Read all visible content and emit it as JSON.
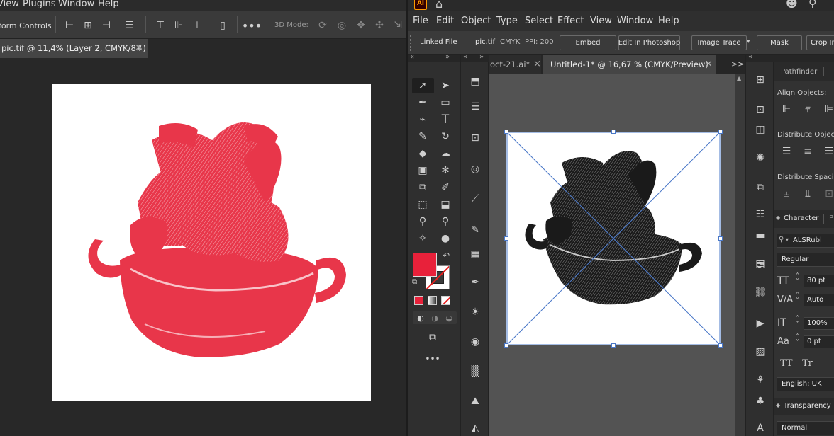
{
  "left": {
    "menu": [
      "View",
      "Plugins",
      "Window",
      "Help"
    ],
    "control_label": "form Controls",
    "threed_label": "3D Mode:",
    "tab_title": "pic.tif @ 11,4% (Layer 2, CMYK/8#)",
    "tab_close": "×"
  },
  "right": {
    "app_logo": "Ai",
    "menu": [
      "File",
      "Edit",
      "Object",
      "Type",
      "Select",
      "Effect",
      "View",
      "Window",
      "Help"
    ],
    "control": {
      "linked_file": "Linked File",
      "file_name": "pic.tif",
      "color_mode": "CMYK",
      "ppi": "PPI: 200",
      "embed": "Embed",
      "edit_in_photoshop": "Edit In Photoshop",
      "image_trace": "Image Trace",
      "mask": "Mask",
      "crop_image": "Crop Ima"
    },
    "tabs": {
      "first": "oct-21.ai*",
      "first_close": "×",
      "second": "Untitled-1* @ 16,67 % (CMYK/Preview)",
      "second_close": "×",
      "overflow": ">>"
    },
    "panel": {
      "pathfinder_tab": "Pathfinder",
      "align_objects": "Align Objects:",
      "distribute_objects": "Distribute Objects",
      "distribute_spacing": "Distribute Spacing",
      "character_tab": "Character",
      "character_tab2": "P",
      "font_family": "ALSRubl",
      "font_style": "Regular",
      "font_size": "80 pt",
      "leading": "Auto",
      "horizontal_scale": "100%",
      "tracking": "0 pt",
      "tt1": "TT",
      "tt2": "Tr",
      "language": "English: UK",
      "transparency_tab": "Transparency",
      "blend_mode": "Normal"
    }
  },
  "colors": {
    "fill": "#e8213a",
    "image_red": "#e8364a",
    "selection_blue": "#4a78c8"
  }
}
